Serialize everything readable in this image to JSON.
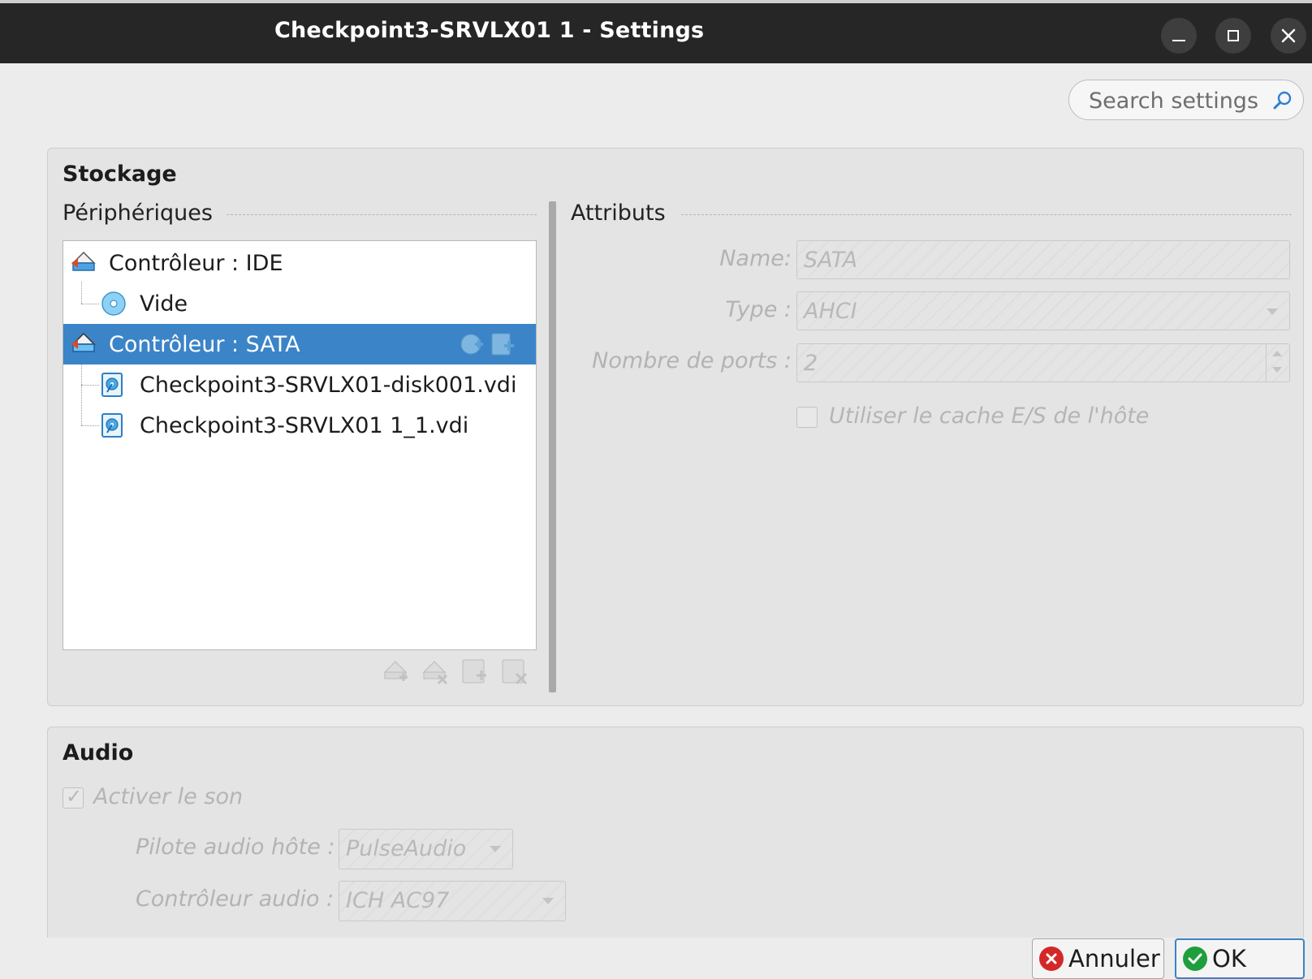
{
  "window": {
    "title": "Checkpoint3-SRVLX01 1 - Settings"
  },
  "search": {
    "placeholder": "Search settings"
  },
  "storage": {
    "section_title": "Stockage",
    "devices_label": "Périphériques",
    "attributes_label": "Attributs",
    "tree": [
      {
        "label": "Contrôleur : IDE",
        "icon": "controller-icon",
        "level": 0,
        "selected": false
      },
      {
        "label": "Vide",
        "icon": "optical-disc-icon",
        "level": 1,
        "selected": false
      },
      {
        "label": "Contrôleur : SATA",
        "icon": "controller-icon",
        "level": 0,
        "selected": true
      },
      {
        "label": "Checkpoint3-SRVLX01-disk001.vdi",
        "icon": "hard-disk-icon",
        "level": 1,
        "selected": false
      },
      {
        "label": "Checkpoint3-SRVLX01 1_1.vdi",
        "icon": "hard-disk-icon",
        "level": 1,
        "selected": false
      }
    ],
    "attributes": {
      "name_label": "Name:",
      "name_value": "SATA",
      "type_label": "Type :",
      "type_value": "AHCI",
      "ports_label": "Nombre de ports :",
      "ports_value": "2",
      "cache_label": "Utiliser le cache E/S de l'hôte",
      "cache_checked": false
    }
  },
  "audio": {
    "section_title": "Audio",
    "enable_label": "Activer le son",
    "enable_checked": true,
    "driver_label": "Pilote audio hôte :",
    "driver_value": "PulseAudio",
    "controller_label": "Contrôleur audio :",
    "controller_value": "ICH AC97"
  },
  "buttons": {
    "cancel": "Annuler",
    "ok": "OK"
  },
  "colors": {
    "titlebar": "#262626",
    "selection": "#3b84c7",
    "cancel_icon": "#d42828",
    "ok_icon": "#1f9e3d"
  }
}
